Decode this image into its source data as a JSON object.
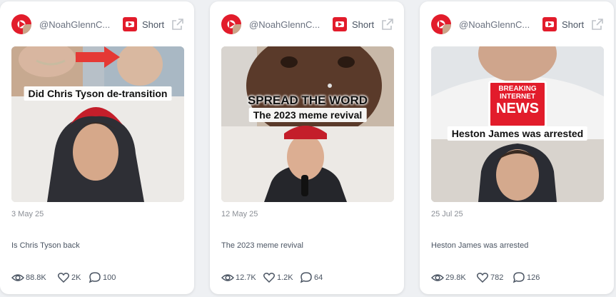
{
  "cards": [
    {
      "handle": "@NoahGlennC...",
      "type_label": "Short",
      "overlay_text": "Did Chris Tyson de-transition",
      "date": "3 May 25",
      "title": "Is Chris Tyson back",
      "views": "88.8K",
      "likes": "2K",
      "comments": "100"
    },
    {
      "handle": "@NoahGlennC...",
      "type_label": "Short",
      "overlay_big": "SPREAD THE WORD",
      "overlay_text": "The 2023 meme revival",
      "date": "12 May 25",
      "title": "The 2023 meme revival",
      "views": "12.7K",
      "likes": "1.2K",
      "comments": "64"
    },
    {
      "handle": "@NoahGlennC...",
      "type_label": "Short",
      "badge": [
        "BREAKING",
        "INTERNET",
        "NEWS"
      ],
      "overlay_text": "Heston James was arrested",
      "date": "25 Jul 25",
      "title": "Heston James was arrested",
      "views": "29.8K",
      "likes": "782",
      "comments": "126"
    }
  ],
  "colors": {
    "youtube_red": "#e21c2b",
    "text_muted": "#8b8f96",
    "text_body": "#4b5563"
  },
  "icons": [
    "youtube-icon",
    "external-link-icon",
    "eye-icon",
    "heart-icon",
    "comment-icon"
  ]
}
